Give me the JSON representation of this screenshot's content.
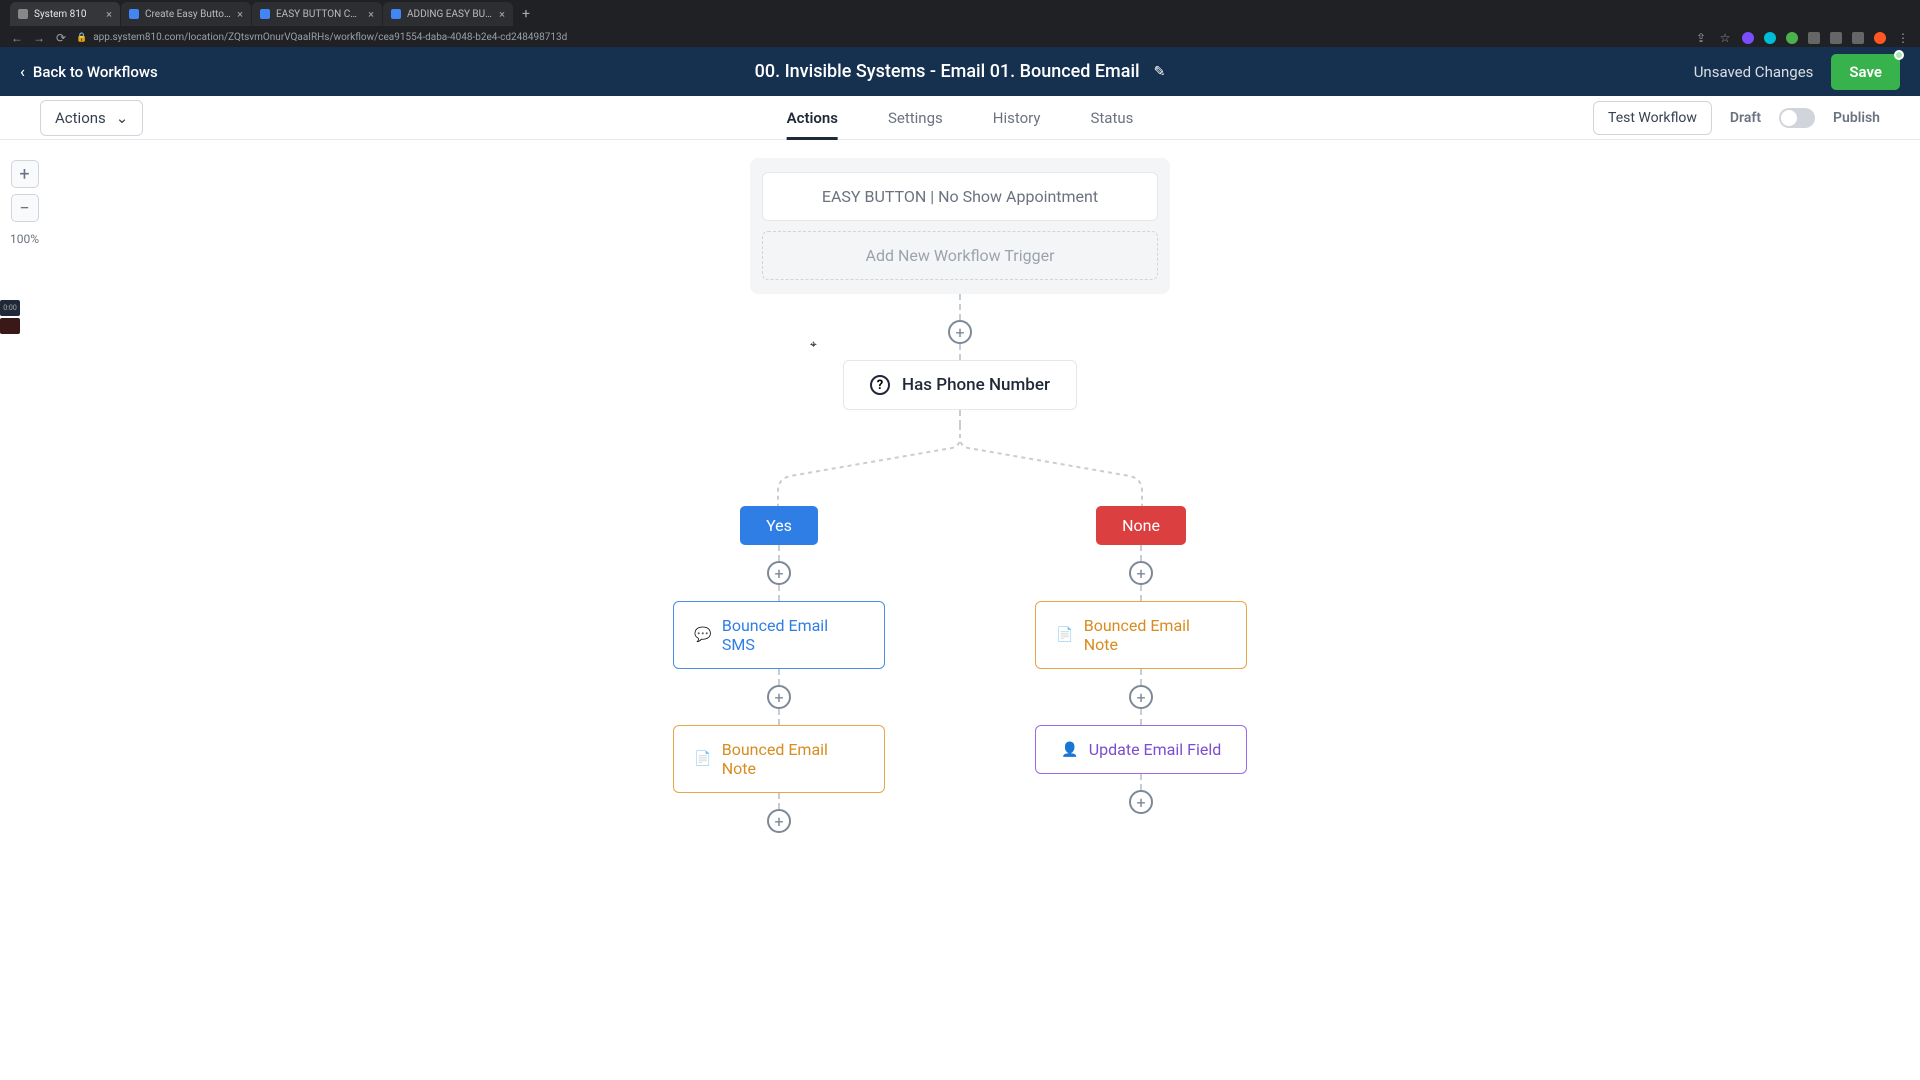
{
  "browser": {
    "tabs": [
      {
        "label": "System 810",
        "active": true
      },
      {
        "label": "Create Easy Buttons Folder GIF",
        "active": false
      },
      {
        "label": "EASY BUTTON Custom Field C",
        "active": false
      },
      {
        "label": "ADDING EASY BUTTON TO W",
        "active": false
      }
    ],
    "url": "app.system810.com/location/ZQtsvmOnurVQaaIRHs/workflow/cea91554-daba-4048-b2e4-cd248498713d"
  },
  "header": {
    "back_label": "Back to Workflows",
    "title": "00. Invisible Systems - Email 01. Bounced Email",
    "unsaved_label": "Unsaved Changes",
    "save_label": "Save"
  },
  "subheader": {
    "actions_label": "Actions",
    "tabs": {
      "actions": "Actions",
      "settings": "Settings",
      "history": "History",
      "status": "Status"
    },
    "test_label": "Test Workflow",
    "draft_label": "Draft",
    "publish_label": "Publish"
  },
  "zoom": {
    "level": "100%"
  },
  "left_widget": {
    "timer": "0:00"
  },
  "flow": {
    "trigger": "EASY BUTTON | No Show Appointment",
    "add_trigger": "Add New Workflow Trigger",
    "condition": "Has Phone Number",
    "branches": {
      "yes_label": "Yes",
      "none_label": "None",
      "yes_actions": [
        {
          "type": "sms",
          "label": "Bounced Email SMS"
        },
        {
          "type": "note",
          "label": "Bounced Email Note"
        }
      ],
      "none_actions": [
        {
          "type": "note",
          "label": "Bounced Email Note"
        },
        {
          "type": "user",
          "label": "Update Email Field"
        }
      ]
    }
  }
}
